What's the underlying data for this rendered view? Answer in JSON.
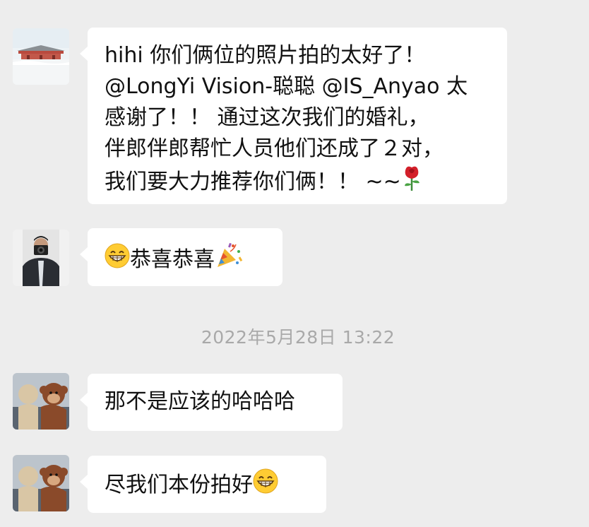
{
  "messages": [
    {
      "lines": [
        "hihi 你们俩位的照片拍的太好了！",
        "@LongYi Vision-聪聪 @IS_Anyao 太",
        "感谢了！！ 通过这次我们的婚礼，",
        "伴郎伴郎帮忙人员他们还成了２对，",
        "我们要大力推荐你们俩！！ ~~"
      ],
      "trailing_icon": "rose-icon"
    },
    {
      "leading_icon": "grinning-face-icon",
      "text": "恭喜恭喜",
      "trailing_icon": "party-popper-icon"
    },
    {
      "text": "那不是应该的哈哈哈"
    },
    {
      "text": "尽我们本份拍好",
      "trailing_icon": "grinning-face-icon"
    }
  ],
  "timestamp": "2022年5月28日 13:22",
  "colors": {
    "background": "#ededed",
    "bubble": "#ffffff",
    "text": "#111111",
    "timestamp": "#a9a9a9"
  }
}
